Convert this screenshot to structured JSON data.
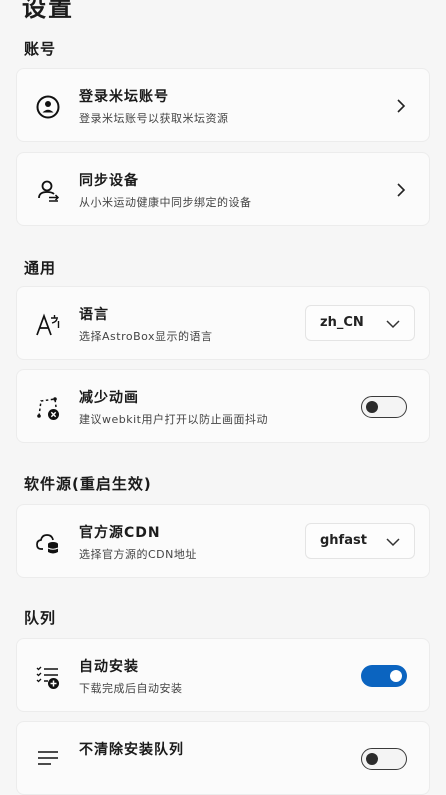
{
  "page": {
    "title": "设置"
  },
  "sections": {
    "account": {
      "title": "账号",
      "login": {
        "title": "登录米坛账号",
        "desc": "登录米坛账号以获取米坛资源"
      },
      "sync": {
        "title": "同步设备",
        "desc": "从小米运动健康中同步绑定的设备"
      }
    },
    "general": {
      "title": "通用",
      "language": {
        "title": "语言",
        "desc": "选择AstroBox显示的语言",
        "value": "zh_CN"
      },
      "reduce_motion": {
        "title": "减少动画",
        "desc": "建议webkit用户打开以防止画面抖动",
        "enabled": false
      }
    },
    "source": {
      "title": "软件源(重启生效)",
      "cdn": {
        "title": "官方源CDN",
        "desc": "选择官方源的CDN地址",
        "value": "ghfast"
      }
    },
    "queue": {
      "title": "队列",
      "auto_install": {
        "title": "自动安装",
        "desc": "下载完成后自动安装",
        "enabled": true
      },
      "keep_queue": {
        "title": "不清除安装队列",
        "enabled": false
      }
    }
  },
  "colors": {
    "accent": "#0b64c0",
    "background": "#f6f6f6",
    "card": "#fbfbfb"
  },
  "icons": [
    "user-circle-icon",
    "sync-user-icon",
    "language-icon",
    "reduce-motion-icon",
    "cloud-db-icon",
    "auto-install-icon",
    "list-icon",
    "chevron-right-icon",
    "chevron-down-icon"
  ]
}
